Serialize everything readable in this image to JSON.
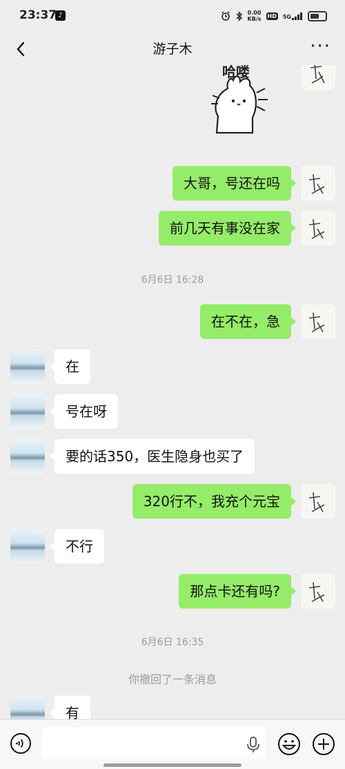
{
  "status_bar": {
    "time": "23:37",
    "net_speed_value": "0.00",
    "net_speed_unit": "KB/s",
    "hd": "HD",
    "signal": "5G"
  },
  "header": {
    "title": "游子木"
  },
  "sticker": {
    "text": "哈喽"
  },
  "messages": [
    {
      "sender": "me",
      "text": "大哥，号还在吗"
    },
    {
      "sender": "me",
      "text": "前几天有事没在家"
    },
    {
      "type": "timestamp",
      "text": "6月6日 16:28"
    },
    {
      "sender": "me",
      "text": "在不在，急"
    },
    {
      "sender": "other",
      "text": "在"
    },
    {
      "sender": "other",
      "text": "号在呀"
    },
    {
      "sender": "other",
      "text": "要的话350，医生隐身也买了"
    },
    {
      "sender": "me",
      "text": "320行不，我充个元宝"
    },
    {
      "sender": "other",
      "text": "不行"
    },
    {
      "sender": "me",
      "text": "那点卡还有吗?"
    },
    {
      "type": "timestamp",
      "text": "6月6日 16:35"
    },
    {
      "type": "system",
      "text": "你撤回了一条消息"
    },
    {
      "sender": "other",
      "text": "有"
    }
  ],
  "input": {
    "placeholder": ""
  },
  "icons": [
    "back-icon",
    "more-icon",
    "voice-icon",
    "mic-icon",
    "emoji-icon",
    "plus-icon",
    "alarm-icon",
    "bluetooth-icon",
    "battery-icon"
  ],
  "colors": {
    "background": "#ededed",
    "my_bubble": "#95ec69",
    "other_bubble": "#ffffff",
    "meta_text": "#9a9a9a"
  }
}
